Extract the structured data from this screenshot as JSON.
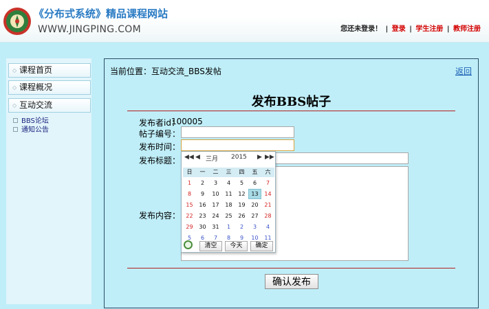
{
  "header": {
    "site_title": "《分布式系统》精品课程网站",
    "site_url": "WWW.JINGPING.COM",
    "login_msg": "您还未登录！",
    "login_link": "登录",
    "student_register": "学生注册",
    "teacher_register": "教师注册",
    "separator": "|"
  },
  "sidebar": {
    "items": [
      {
        "label": "课程首页"
      },
      {
        "label": "课程概况"
      },
      {
        "label": "互动交流"
      }
    ],
    "sub_items": [
      {
        "label": "BBS论坛"
      },
      {
        "label": "通知公告"
      }
    ]
  },
  "main": {
    "breadcrumb": "当前位置：互动交流_BBS发帖",
    "back_link": "返回",
    "title": "发布BBS帖子",
    "fields": {
      "publisher_label": "发布者id：",
      "publisher_value": "100005",
      "post_no_label": "帖子编号：",
      "post_no_value": "",
      "time_label": "发布时间：",
      "time_value": "",
      "subject_label": "发布标题：",
      "subject_value": "",
      "content_label": "发布内容：",
      "content_value": ""
    },
    "submit_label": "确认发布"
  },
  "calendar": {
    "prev_year": "◀◀",
    "prev_month": "◀",
    "month": "三月",
    "year": "2015",
    "next_month": "▶",
    "next_year": "▶▶",
    "weekdays": [
      "日",
      "一",
      "二",
      "三",
      "四",
      "五",
      "六"
    ],
    "weeks": [
      [
        "1",
        "2",
        "3",
        "4",
        "5",
        "6",
        "7"
      ],
      [
        "8",
        "9",
        "10",
        "11",
        "12",
        "13",
        "14"
      ],
      [
        "15",
        "16",
        "17",
        "18",
        "19",
        "20",
        "21"
      ],
      [
        "22",
        "23",
        "24",
        "25",
        "26",
        "27",
        "28"
      ],
      [
        "29",
        "30",
        "31",
        "1",
        "2",
        "3",
        "4"
      ],
      [
        "5",
        "6",
        "7",
        "8",
        "9",
        "10",
        "11"
      ]
    ],
    "selected_day": "13",
    "clear_label": "清空",
    "today_label": "今天",
    "ok_label": "确定"
  },
  "colors": {
    "background": "#bfeef8",
    "accent_red": "#d40000",
    "title_blue": "#2a7bc4",
    "rule_red": "#b41e1e"
  }
}
